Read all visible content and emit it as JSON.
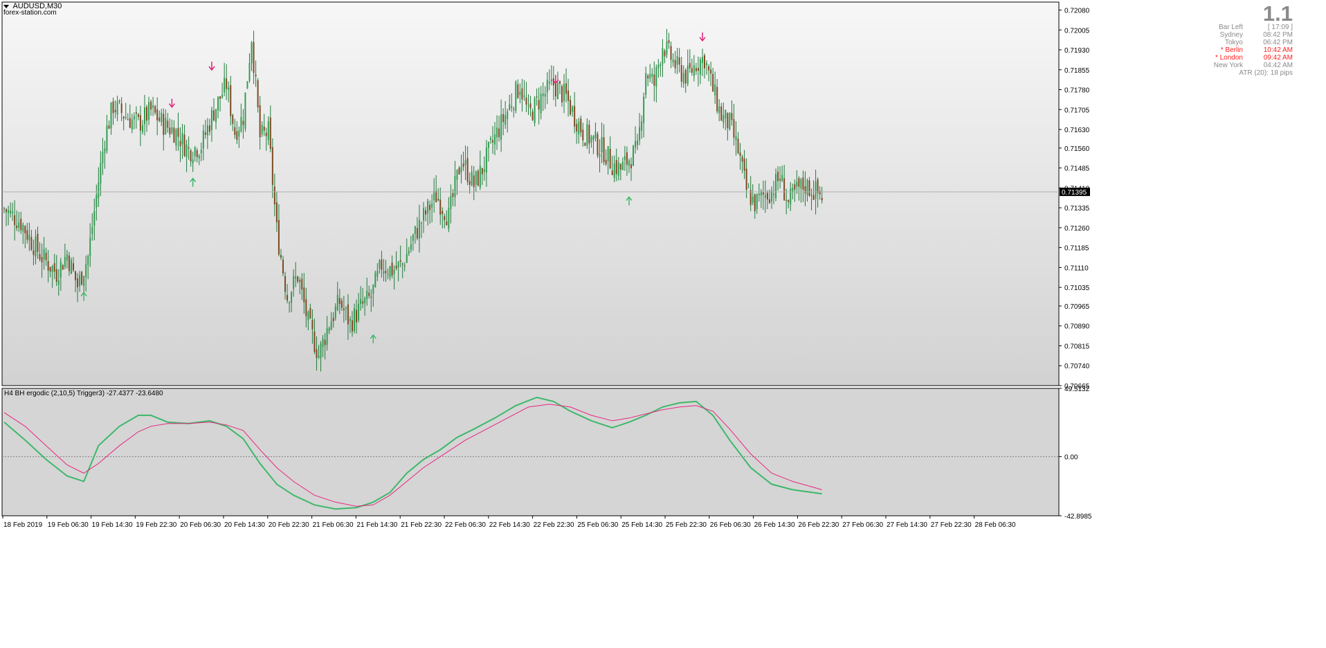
{
  "header": {
    "symbol": "AUDUSD,M30",
    "watermark": "forex-station.com"
  },
  "info_panel": {
    "big_value": "1.1",
    "rows": [
      {
        "label": "Bar Left",
        "value": "[ 17:09 ]",
        "highlight": false
      },
      {
        "label": "Sydney",
        "value": "08:42 PM",
        "highlight": false
      },
      {
        "label": "Tokyo",
        "value": "06:42 PM",
        "highlight": false
      },
      {
        "label": "* Berlin",
        "value": "10:42 AM",
        "highlight": true
      },
      {
        "label": "* London",
        "value": "09:42 AM",
        "highlight": true
      },
      {
        "label": "New York",
        "value": "04:42 AM",
        "highlight": false
      },
      {
        "label": "ATR (20): 18 pips",
        "value": "",
        "highlight": false
      }
    ]
  },
  "colors": {
    "bull": "#2f9e4f",
    "bear": "#7a4a22",
    "wick": "#1f7a3a",
    "fast": "#3cb86a",
    "slow": "#e8257f",
    "up_arrow": "#3cb86a",
    "down_arrow": "#e0207a"
  },
  "chart_data": [
    {
      "type": "candlestick",
      "title": "AUDUSD,M30",
      "ylim": [
        0.70665,
        0.7211
      ],
      "y_ticks": [
        "0.72080",
        "0.72005",
        "0.71930",
        "0.71855",
        "0.71780",
        "0.71705",
        "0.71630",
        "0.71560",
        "0.71485",
        "0.71410",
        "0.71335",
        "0.71260",
        "0.71185",
        "0.71110",
        "0.71035",
        "0.70965",
        "0.70890",
        "0.70815",
        "0.70740",
        "0.70665"
      ],
      "current_price": "0.71395",
      "x_ticks": [
        "18 Feb 2019",
        "19 Feb 06:30",
        "19 Feb 14:30",
        "19 Feb 22:30",
        "20 Feb 06:30",
        "20 Feb 14:30",
        "20 Feb 22:30",
        "21 Feb 06:30",
        "21 Feb 14:30",
        "21 Feb 22:30",
        "22 Feb 06:30",
        "22 Feb 14:30",
        "22 Feb 22:30",
        "25 Feb 06:30",
        "25 Feb 14:30",
        "25 Feb 22:30",
        "26 Feb 06:30",
        "26 Feb 14:30",
        "26 Feb 22:30",
        "27 Feb 06:30",
        "27 Feb 14:30",
        "27 Feb 22:30",
        "28 Feb 06:30"
      ],
      "close_path": [
        [
          0,
          0.7133
        ],
        [
          8,
          0.7128
        ],
        [
          13,
          0.7121
        ],
        [
          18,
          0.7115
        ],
        [
          25,
          0.7109
        ],
        [
          30,
          0.7116
        ],
        [
          35,
          0.7104
        ],
        [
          40,
          0.7115
        ],
        [
          44,
          0.7138
        ],
        [
          48,
          0.716
        ],
        [
          52,
          0.7172
        ],
        [
          58,
          0.7168
        ],
        [
          64,
          0.7165
        ],
        [
          70,
          0.717
        ],
        [
          76,
          0.7165
        ],
        [
          82,
          0.7162
        ],
        [
          88,
          0.7155
        ],
        [
          94,
          0.7157
        ],
        [
          100,
          0.717
        ],
        [
          106,
          0.718
        ],
        [
          110,
          0.7162
        ],
        [
          114,
          0.7168
        ],
        [
          118,
          0.7198
        ],
        [
          122,
          0.716
        ],
        [
          126,
          0.7162
        ],
        [
          130,
          0.7125
        ],
        [
          135,
          0.71
        ],
        [
          140,
          0.7108
        ],
        [
          145,
          0.709
        ],
        [
          150,
          0.7078
        ],
        [
          155,
          0.709
        ],
        [
          160,
          0.7098
        ],
        [
          165,
          0.709
        ],
        [
          170,
          0.7096
        ],
        [
          175,
          0.71
        ],
        [
          180,
          0.7112
        ],
        [
          185,
          0.711
        ],
        [
          190,
          0.7112
        ],
        [
          195,
          0.7122
        ],
        [
          200,
          0.713
        ],
        [
          206,
          0.7138
        ],
        [
          212,
          0.713
        ],
        [
          218,
          0.7152
        ],
        [
          224,
          0.7142
        ],
        [
          228,
          0.7148
        ],
        [
          234,
          0.716
        ],
        [
          240,
          0.717
        ],
        [
          246,
          0.718
        ],
        [
          250,
          0.7168
        ],
        [
          256,
          0.7175
        ],
        [
          262,
          0.718
        ],
        [
          268,
          0.7175
        ],
        [
          272,
          0.7168
        ],
        [
          276,
          0.7162
        ],
        [
          282,
          0.7158
        ],
        [
          286,
          0.7155
        ],
        [
          290,
          0.715
        ],
        [
          294,
          0.7148
        ],
        [
          298,
          0.7152
        ],
        [
          302,
          0.7155
        ],
        [
          306,
          0.7185
        ],
        [
          310,
          0.718
        ],
        [
          314,
          0.7195
        ],
        [
          318,
          0.719
        ],
        [
          322,
          0.7185
        ],
        [
          326,
          0.7183
        ],
        [
          330,
          0.7188
        ],
        [
          334,
          0.719
        ],
        [
          338,
          0.7178
        ],
        [
          342,
          0.7168
        ],
        [
          346,
          0.7165
        ],
        [
          350,
          0.7155
        ],
        [
          354,
          0.714
        ],
        [
          358,
          0.7135
        ],
        [
          362,
          0.7138
        ],
        [
          366,
          0.714
        ],
        [
          370,
          0.7145
        ],
        [
          374,
          0.7135
        ],
        [
          378,
          0.714
        ],
        [
          382,
          0.7142
        ],
        [
          386,
          0.714
        ],
        [
          390,
          0.7138
        ]
      ],
      "up_arrows": [
        [
          38,
          0.71
        ],
        [
          90,
          0.7143
        ],
        [
          176,
          0.7084
        ],
        [
          298,
          0.7136
        ]
      ],
      "down_arrows": [
        [
          80,
          0.7173
        ],
        [
          99,
          0.7187
        ],
        [
          263,
          0.7182
        ],
        [
          333,
          0.7198
        ]
      ]
    },
    {
      "type": "line",
      "title": "H4 BH ergodic (2,10,5) Trigger3) -27.4377 -23.6480",
      "ylim": [
        -42.8985,
        49.5132
      ],
      "y_ticks": [
        "49.5132",
        "0.00",
        "-42.8985"
      ],
      "series": [
        {
          "values": [
            [
              0,
              25
            ],
            [
              10,
              12
            ],
            [
              20,
              -2
            ],
            [
              30,
              -14
            ],
            [
              38,
              -18
            ],
            [
              45,
              8
            ],
            [
              55,
              22
            ],
            [
              64,
              30
            ],
            [
              70,
              30
            ],
            [
              78,
              25
            ],
            [
              88,
              24
            ],
            [
              98,
              26
            ],
            [
              106,
              22
            ],
            [
              114,
              13
            ],
            [
              122,
              -5
            ],
            [
              130,
              -20
            ],
            [
              138,
              -28
            ],
            [
              148,
              -35
            ],
            [
              158,
              -38
            ],
            [
              168,
              -37
            ],
            [
              176,
              -33
            ],
            [
              184,
              -26
            ],
            [
              192,
              -12
            ],
            [
              200,
              -2
            ],
            [
              208,
              5
            ],
            [
              216,
              14
            ],
            [
              224,
              20
            ],
            [
              234,
              28
            ],
            [
              244,
              37
            ],
            [
              254,
              43
            ],
            [
              262,
              40
            ],
            [
              270,
              33
            ],
            [
              280,
              26
            ],
            [
              290,
              21
            ],
            [
              298,
              25
            ],
            [
              306,
              30
            ],
            [
              314,
              36
            ],
            [
              322,
              39
            ],
            [
              330,
              40
            ],
            [
              338,
              30
            ],
            [
              346,
              12
            ],
            [
              356,
              -8
            ],
            [
              366,
              -20
            ],
            [
              376,
              -24
            ],
            [
              390,
              -27
            ]
          ]
        },
        {
          "values": [
            [
              0,
              32
            ],
            [
              10,
              22
            ],
            [
              20,
              8
            ],
            [
              30,
              -6
            ],
            [
              38,
              -12
            ],
            [
              45,
              -5
            ],
            [
              55,
              8
            ],
            [
              64,
              18
            ],
            [
              70,
              22
            ],
            [
              78,
              24
            ],
            [
              88,
              24
            ],
            [
              98,
              25
            ],
            [
              106,
              23
            ],
            [
              114,
              19
            ],
            [
              122,
              5
            ],
            [
              130,
              -8
            ],
            [
              138,
              -18
            ],
            [
              148,
              -28
            ],
            [
              158,
              -33
            ],
            [
              168,
              -36
            ],
            [
              176,
              -35
            ],
            [
              184,
              -28
            ],
            [
              192,
              -18
            ],
            [
              200,
              -8
            ],
            [
              210,
              2
            ],
            [
              220,
              12
            ],
            [
              230,
              20
            ],
            [
              240,
              28
            ],
            [
              250,
              36
            ],
            [
              260,
              38
            ],
            [
              270,
              36
            ],
            [
              280,
              30
            ],
            [
              290,
              26
            ],
            [
              298,
              28
            ],
            [
              306,
              31
            ],
            [
              314,
              34
            ],
            [
              322,
              36
            ],
            [
              330,
              37
            ],
            [
              338,
              33
            ],
            [
              346,
              20
            ],
            [
              356,
              2
            ],
            [
              366,
              -12
            ],
            [
              376,
              -18
            ],
            [
              390,
              -24
            ]
          ]
        }
      ]
    }
  ]
}
